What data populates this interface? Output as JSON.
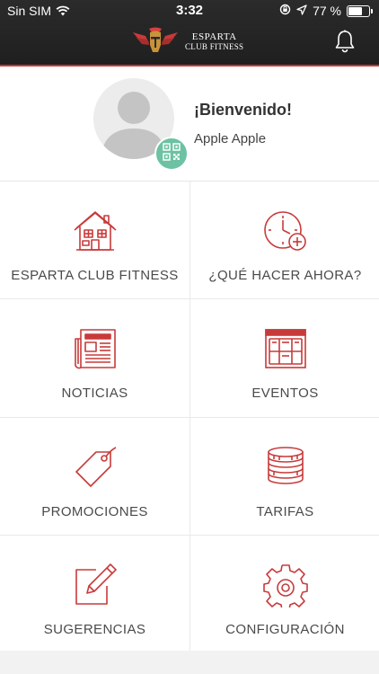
{
  "status_bar": {
    "carrier": "Sin SIM",
    "time": "3:32",
    "battery": "77 %",
    "battery_level": 0.77
  },
  "header": {
    "brand_line1": "ESPARTA",
    "brand_line2": "CLUB FITNESS",
    "icons": [
      "spartan-helmet-logo",
      "bell-icon"
    ]
  },
  "profile": {
    "welcome": "¡Bienvenido!",
    "name": "Apple Apple",
    "icons": [
      "avatar-placeholder",
      "qr-code-icon"
    ]
  },
  "menu": {
    "items": [
      {
        "label": "ESPARTA CLUB FITNESS",
        "icon": "house-icon"
      },
      {
        "label": "¿QUÉ HACER AHORA?",
        "icon": "clock-plus-icon"
      },
      {
        "label": "NOTICIAS",
        "icon": "newspaper-icon"
      },
      {
        "label": "EVENTOS",
        "icon": "calendar-board-icon"
      },
      {
        "label": "PROMOCIONES",
        "icon": "price-tag-icon"
      },
      {
        "label": "TARIFAS",
        "icon": "coins-icon"
      },
      {
        "label": "SUGERENCIAS",
        "icon": "edit-note-icon"
      },
      {
        "label": "CONFIGURACIÓN",
        "icon": "gear-icon"
      }
    ]
  },
  "colors": {
    "accent": "#c83a3a",
    "header_bg": "#232323",
    "qr_badge": "#6cc2a2",
    "divider": "#e9e9e9"
  }
}
